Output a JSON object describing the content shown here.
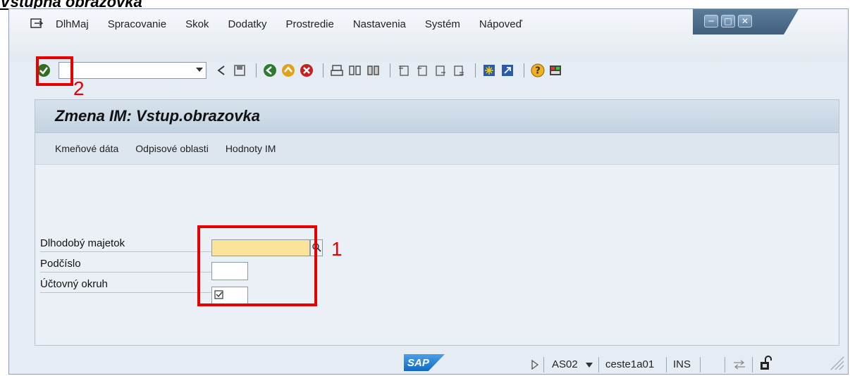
{
  "doc_heading": "Vstupná obrazovka",
  "menu": [
    "DlhMaj",
    "Spracovanie",
    "Skok",
    "Dodatky",
    "Prostredie",
    "Nastavenia",
    "Systém",
    "Nápoveď"
  ],
  "screen": {
    "title": "Zmena IM: Vstup.obrazovka",
    "app_buttons": [
      "Kmeňové dáta",
      "Odpisové oblasti",
      "Hodnoty IM"
    ]
  },
  "fields": {
    "asset_label": "Dlhodobý majetok",
    "subnumber_label": "Podčíslo",
    "company_code_label": "Účtovný okruh",
    "asset_value": "",
    "subnumber_value": "",
    "company_code_value": ""
  },
  "annotations": {
    "one": "1",
    "two": "2"
  },
  "status": {
    "logo": "SAP",
    "transaction": "AS02",
    "server": "ceste1a01",
    "mode": "INS"
  },
  "colors": {
    "annotation_red": "#e60000",
    "input_highlight": "#fbe39a"
  }
}
